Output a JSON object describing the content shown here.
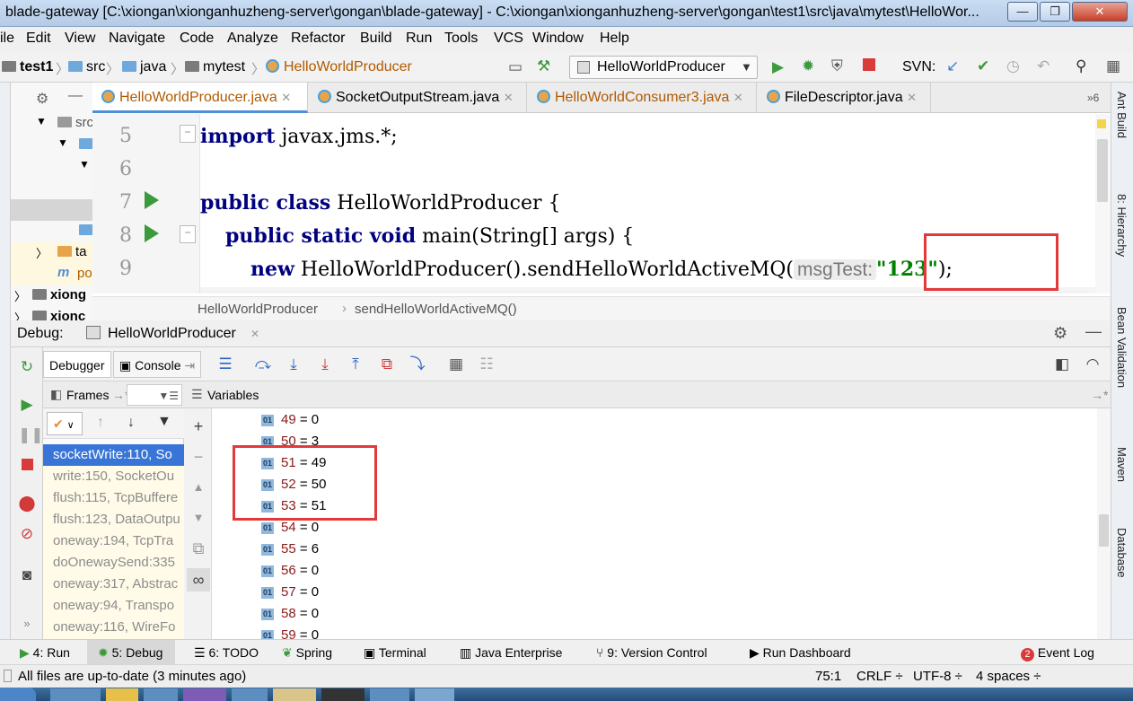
{
  "window": {
    "title": "blade-gateway [C:\\xiongan\\xionganhuzheng-server\\gongan\\blade-gateway] - C:\\xiongan\\xionganhuzheng-server\\gongan\\test1\\src\\java\\mytest\\HelloWor...",
    "minimize": "—",
    "maximize": "❐",
    "close": "✕"
  },
  "menu": [
    "ile",
    "Edit",
    "View",
    "Navigate",
    "Code",
    "Analyze",
    "Refactor",
    "Build",
    "Run",
    "Tools",
    "VCS",
    "Window",
    "Help"
  ],
  "nav": {
    "crumbs": [
      "test1",
      "src",
      "java",
      "mytest",
      "HelloWorldProducer"
    ],
    "run_config": "HelloWorldProducer",
    "svn_label": "SVN:"
  },
  "project_tree": {
    "items": [
      "src",
      "ta",
      "po",
      "xiong",
      "xionc"
    ]
  },
  "editor": {
    "tabs": [
      "HelloWorldProducer.java",
      "SocketOutputStream.java",
      "HelloWorldConsumer3.java",
      "FileDescriptor.java"
    ],
    "tab_overflow": "»6",
    "lines": [
      {
        "num": "5",
        "parts": [
          [
            "kw",
            "import"
          ],
          [
            "plain",
            " javax.jms.*;"
          ]
        ]
      },
      {
        "num": "6",
        "parts": []
      },
      {
        "num": "7",
        "parts": [
          [
            "kw",
            "public class"
          ],
          [
            "plain",
            " HelloWorldProducer {"
          ]
        ]
      },
      {
        "num": "8",
        "parts": [
          [
            "plain",
            "    "
          ],
          [
            "kw",
            "public static void"
          ],
          [
            "plain",
            " main(String[] args) {"
          ]
        ]
      },
      {
        "num": "9",
        "parts": [
          [
            "plain",
            "        "
          ],
          [
            "kw",
            "new"
          ],
          [
            "plain",
            " HelloWorldProducer().sendHelloWorldActiveMQ("
          ],
          [
            "hint",
            "msgTest:"
          ],
          [
            "str",
            "\"123\""
          ],
          [
            "plain",
            ");"
          ]
        ]
      }
    ],
    "breadcrumb": [
      "HelloWorldProducer",
      "sendHelloWorldActiveMQ()"
    ]
  },
  "right_tools": [
    "Ant Build",
    "8: Hierarchy",
    "Bean Validation",
    "Maven",
    "Database"
  ],
  "debug": {
    "label": "Debug:",
    "session": "HelloWorldProducer",
    "tabs": [
      "Debugger",
      "Console"
    ],
    "frames_label": "Frames",
    "variables_label": "Variables",
    "frames": [
      "socketWrite:110, So",
      "write:150, SocketOu",
      "flush:115, TcpBuffere",
      "flush:123, DataOutpu",
      "oneway:194, TcpTra",
      "doOnewaySend:335",
      "oneway:317, Abstrac",
      "oneway:94, Transpo",
      "oneway:116, WireFo"
    ],
    "variables": [
      {
        "name": "49",
        "value": "0"
      },
      {
        "name": "50",
        "value": "3"
      },
      {
        "name": "51",
        "value": "49"
      },
      {
        "name": "52",
        "value": "50"
      },
      {
        "name": "53",
        "value": "51"
      },
      {
        "name": "54",
        "value": "0"
      },
      {
        "name": "55",
        "value": "6"
      },
      {
        "name": "56",
        "value": "0"
      },
      {
        "name": "57",
        "value": "0"
      },
      {
        "name": "58",
        "value": "0"
      },
      {
        "name": "59",
        "value": "0"
      }
    ],
    "var_badge": "01"
  },
  "toolwindows": [
    "4: Run",
    "5: Debug",
    "6: TODO",
    "Spring",
    "Terminal",
    "Java Enterprise",
    "9: Version Control",
    "Run Dashboard",
    "Event Log"
  ],
  "event_log_count": "2",
  "status": {
    "message": "All files are up-to-date (3 minutes ago)",
    "position": "75:1",
    "line_sep": "CRLF ÷",
    "encoding": "UTF-8 ÷",
    "indent": "4 spaces ÷"
  },
  "colors": {
    "accent": "#3875d6",
    "highlight_box": "#e23a3a",
    "keyword": "#000080",
    "string": "#008000"
  }
}
